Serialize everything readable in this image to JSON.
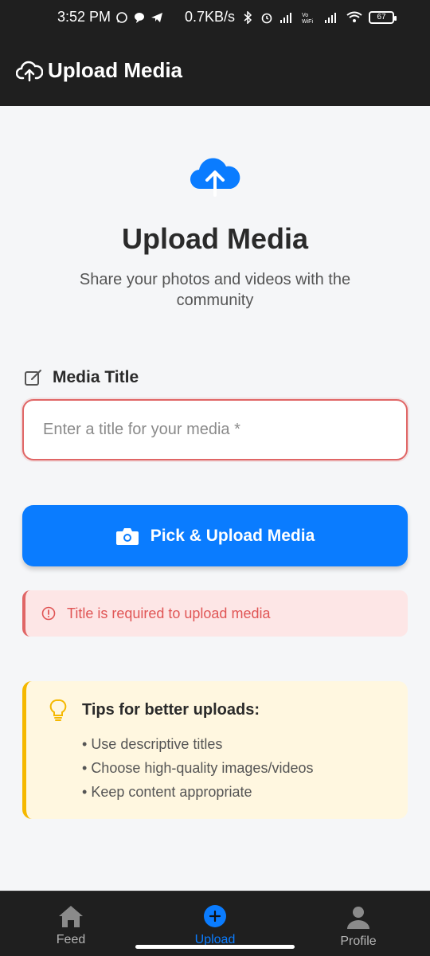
{
  "status_bar": {
    "time": "3:52 PM",
    "speed": "0.7KB/s",
    "battery": "67",
    "icons": [
      "whatsapp-icon",
      "message-icon",
      "telegram-icon",
      "bluetooth-icon",
      "alarm-icon",
      "signal-icon",
      "vowifi-icon",
      "wifi-icon",
      "battery-icon"
    ]
  },
  "header": {
    "title": "Upload Media",
    "icon": "cloud-upload-icon"
  },
  "hero": {
    "icon": "cloud-upload-icon",
    "title": "Upload Media",
    "subtitle": "Share your photos and videos with the community"
  },
  "form": {
    "label": "Media Title",
    "label_icon": "edit-icon",
    "placeholder": "Enter a title for your media *",
    "value": "",
    "upload_button": "Pick & Upload Media",
    "upload_icon": "camera-icon"
  },
  "error": {
    "text": "Title is required to upload media",
    "icon": "alert-circle-icon"
  },
  "tips": {
    "title": "Tips for better uploads:",
    "icon": "lightbulb-icon",
    "items": [
      "Use descriptive titles",
      "Choose high-quality images/videos",
      "Keep content appropriate"
    ]
  },
  "nav": {
    "items": [
      {
        "label": "Feed",
        "icon": "home-icon"
      },
      {
        "label": "Upload",
        "icon": "plus-circle-icon"
      },
      {
        "label": "Profile",
        "icon": "user-icon"
      }
    ],
    "active": "Upload"
  },
  "colors": {
    "accent": "#0a7cff",
    "error": "#e05555",
    "warning": "#f5b800",
    "dark": "#1f1f1f"
  }
}
